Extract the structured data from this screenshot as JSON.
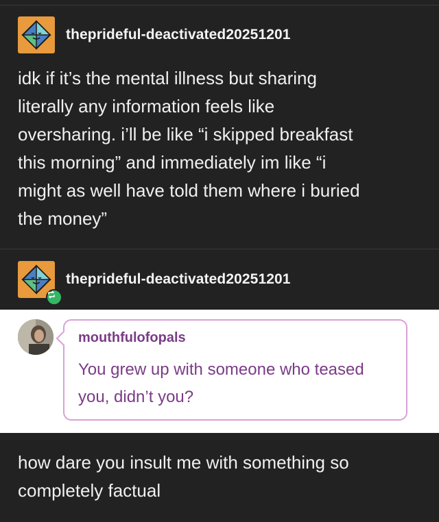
{
  "post": {
    "username": "theprideful-deactivated20251201",
    "lines": [
      "idk if it’s the mental illness but sharing",
      "literally any information feels like",
      "oversharing. i’ll be like “i skipped breakfast",
      "this morning” and immediately im like “i",
      "might as well have told them where i buried",
      "the money”"
    ]
  },
  "reblog": {
    "username": "theprideful-deactivated20251201",
    "ask": {
      "asker": "mouthfulofopals",
      "question_lines": [
        "You grew up with someone who teased",
        "you, didn’t you?"
      ]
    },
    "answer_lines": [
      "how dare you insult me with something so",
      "completely factual"
    ]
  },
  "colors": {
    "background": "#222222",
    "avatar": "#e89a3c",
    "ask_text": "#7a3c86",
    "ask_border": "#d9a0d6",
    "reblog_badge": "#35b665"
  },
  "icons": {
    "avatar": "diamond-face-icon",
    "reblog": "reblog-icon"
  }
}
